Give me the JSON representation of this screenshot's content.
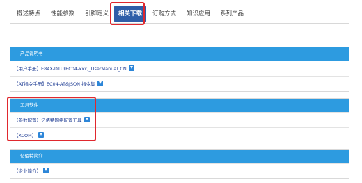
{
  "tabs": [
    "概述特点",
    "性能参数",
    "引脚定义",
    "相关下载",
    "订购方式",
    "知识应用",
    "系列产品"
  ],
  "active_tab": "相关下载",
  "sections": [
    {
      "title": "产品说明书",
      "items": [
        "【用户手册】E84X-DTU(EC04-xxx)_UserManual_CN",
        "【AT指令手册】EC04-AT&JSON 指令集"
      ]
    },
    {
      "title": "工具软件",
      "items": [
        "【参数配置】亿佰特网络配置工具",
        "【XCOM】"
      ]
    },
    {
      "title": "亿佰特简介",
      "items": [
        "【企业简介】"
      ]
    }
  ],
  "colors": {
    "accent": "#2f5ea8",
    "section_header": "#2d9be0",
    "highlight": "#e0282e",
    "link": "#1f3d94"
  },
  "icons": {
    "download": "download-icon"
  }
}
